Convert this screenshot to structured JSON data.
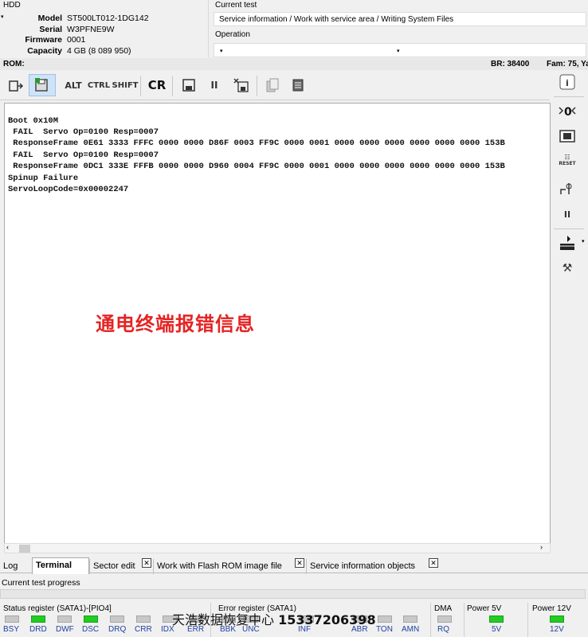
{
  "hdd": {
    "group_title": "HDD",
    "model_label": "Model",
    "model": "ST500LT012-1DG142",
    "serial_label": "Serial",
    "serial": "W3PFNE9W",
    "firmware_label": "Firmware",
    "firmware": "0001",
    "capacity_label": "Capacity",
    "capacity": "4 GB (8 089 950)"
  },
  "current_test": {
    "group_title": "Current test",
    "value": "Service information / Work with service area / Writing System Files"
  },
  "operation": {
    "group_title": "Operation"
  },
  "rom_bar": {
    "label": "ROM:",
    "br": "BR: 38400",
    "fam": "Fam: 75, Ya"
  },
  "toolbar": {
    "alt": "ALT",
    "ctrl": "CTRL",
    "shift": "SHIFT",
    "cr": "CR",
    "pause": "II"
  },
  "terminal": {
    "lines": [
      "Boot 0x10M",
      " FAIL  Servo Op=0100 Resp=0007",
      " ResponseFrame 0E61 3333 FFFC 0000 0000 D86F 0003 FF9C 0000 0001 0000 0000 0000 0000 0000 0000 153B",
      " FAIL  Servo Op=0100 Resp=0007",
      " ResponseFrame 0DC1 333E FFFB 0000 0000 D960 0004 FF9C 0000 0001 0000 0000 0000 0000 0000 0000 153B",
      "Spinup Failure",
      "ServoLoopCode=0x00002247"
    ],
    "overlay_text": "通电终端报错信息"
  },
  "sidebar": {
    "reset": "RESET",
    "pause": "II"
  },
  "tabs": [
    {
      "label": "Log"
    },
    {
      "label": "Terminal"
    },
    {
      "label": "Sector edit"
    },
    {
      "label": "Work with Flash ROM image file"
    },
    {
      "label": "Service information objects"
    }
  ],
  "progress": {
    "label": "Current test progress"
  },
  "status_register": {
    "title": "Status register (SATA1)-[PIO4]",
    "leds": [
      {
        "label": "BSY",
        "on": false
      },
      {
        "label": "DRD",
        "on": true
      },
      {
        "label": "DWF",
        "on": false
      },
      {
        "label": "DSC",
        "on": true
      },
      {
        "label": "DRQ",
        "on": false
      },
      {
        "label": "CRR",
        "on": false
      },
      {
        "label": "IDX",
        "on": false
      },
      {
        "label": "ERR",
        "on": false
      }
    ]
  },
  "error_register": {
    "title": "Error register (SATA1)",
    "leds": [
      {
        "label": "BBK"
      },
      {
        "label": "UNC"
      },
      {
        "label": "INF"
      },
      {
        "label": "ABR"
      },
      {
        "label": "TON"
      },
      {
        "label": "AMN"
      }
    ]
  },
  "dma": {
    "title": "DMA",
    "led_label": "RQ"
  },
  "power5": {
    "title": "Power 5V",
    "led_label": "5V",
    "on": true
  },
  "power12": {
    "title": "Power 12V",
    "led_label": "12V",
    "on": true
  },
  "watermark": {
    "text": "天浩数据恢复中心",
    "phone": "15337206398"
  },
  "colors": {
    "led_on": "#22cc22",
    "led_off": "#c8c8c8",
    "overlay": "#e52323",
    "led_label": "#2040a0"
  }
}
